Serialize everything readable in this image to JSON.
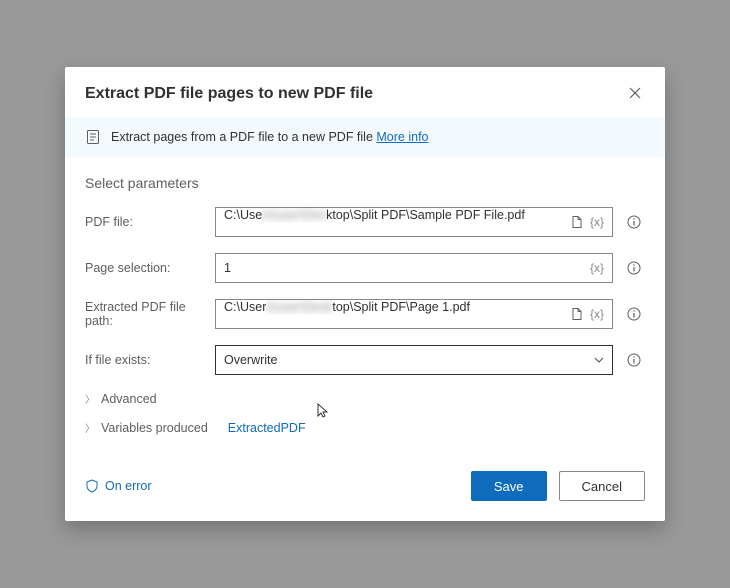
{
  "dialog": {
    "title": "Extract PDF file pages to new PDF file",
    "infoText": "Extract pages from a PDF file to a new PDF file",
    "moreInfo": "More info",
    "sectionTitle": "Select parameters"
  },
  "fields": {
    "pdfFile": {
      "label": "PDF file:",
      "value_prefix": "C:\\Use",
      "value_blur": "rs\\user\\Des",
      "value_suffix": "ktop\\Split PDF\\Sample PDF File.pdf"
    },
    "pageSelection": {
      "label": "Page selection:",
      "value": "1"
    },
    "extractedPath": {
      "label": "Extracted PDF file path:",
      "value_prefix": "C:\\User",
      "value_blur": "s\\user\\Desk",
      "value_suffix": "top\\Split PDF\\Page 1.pdf"
    },
    "ifExists": {
      "label": "If file exists:",
      "value": "Overwrite"
    },
    "varToken": "{x}"
  },
  "expanders": {
    "advanced": "Advanced",
    "variablesProduced": "Variables produced",
    "variableName": "ExtractedPDF"
  },
  "footer": {
    "onError": "On error",
    "save": "Save",
    "cancel": "Cancel"
  }
}
